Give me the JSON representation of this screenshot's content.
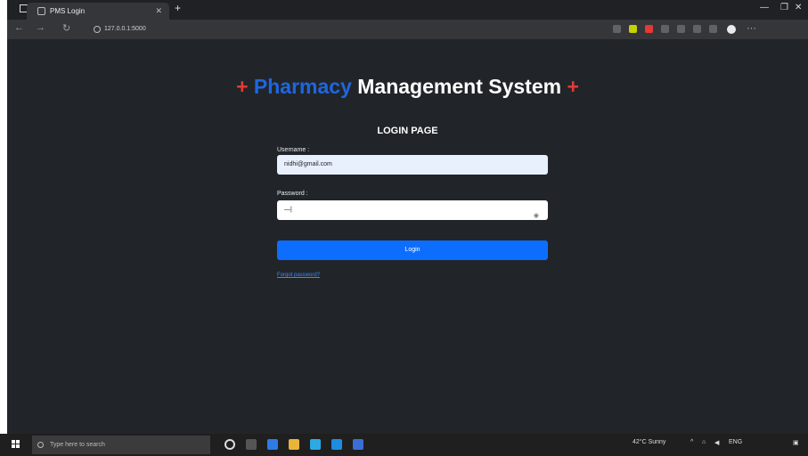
{
  "browser": {
    "tab_title": "PMS Login",
    "url": "127.0.0.1:5000",
    "colors": {
      "accent_red": "#e53935",
      "accent_blue": "#1f66e0"
    }
  },
  "page": {
    "title_plus_left": "+",
    "title_brand": "Pharmacy",
    "title_rest": "Management System",
    "title_plus_right": "+",
    "heading": "LOGIN PAGE",
    "username_label": "Username :",
    "username_value": "nidhi@gmail.com",
    "password_label": "Password :",
    "password_value": "—|",
    "login_label": "Login",
    "forgot_label": "Forgot password?"
  },
  "taskbar": {
    "search_placeholder": "Type here to search",
    "weather": "42°C Sunny",
    "lang": "ENG"
  }
}
